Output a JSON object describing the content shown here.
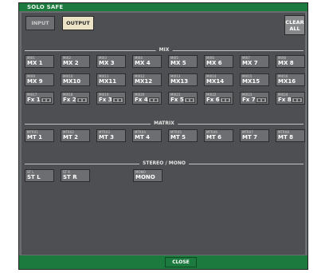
{
  "window": {
    "title": "SOLO SAFE"
  },
  "tabs": {
    "input": "INPUT",
    "output": "OUTPUT"
  },
  "clear": {
    "line1": "CLEAR",
    "line2": "ALL"
  },
  "sections": {
    "mix": "MIX",
    "matrix": "MATRIX",
    "stereo_mono": "STEREO / MONO"
  },
  "mix": [
    {
      "top": "MIX1",
      "main": "MX 1"
    },
    {
      "top": "MIX2",
      "main": "MX 2"
    },
    {
      "top": "MIX3",
      "main": "MX 3"
    },
    {
      "top": "MIX4",
      "main": "MX 4"
    },
    {
      "top": "MIX5",
      "main": "MX 5"
    },
    {
      "top": "MIX6",
      "main": "MX 6"
    },
    {
      "top": "MIX7",
      "main": "MX 7"
    },
    {
      "top": "MIX8",
      "main": "MX 8"
    },
    {
      "top": "MIX9",
      "main": "MX 9"
    },
    {
      "top": "MIX10",
      "main": "MX10"
    },
    {
      "top": "MIX11",
      "main": "MX11"
    },
    {
      "top": "MIX12",
      "main": "MX12"
    },
    {
      "top": "MIX13",
      "main": "MX13"
    },
    {
      "top": "MIX14",
      "main": "MX14"
    },
    {
      "top": "MIX15",
      "main": "MX15"
    },
    {
      "top": "MIX16",
      "main": "MX16"
    },
    {
      "top": "MIX17",
      "main": "Fx 1"
    },
    {
      "top": "MIX18",
      "main": "Fx 2"
    },
    {
      "top": "MIX19",
      "main": "Fx 3"
    },
    {
      "top": "MIX20",
      "main": "Fx 4"
    },
    {
      "top": "MIX21",
      "main": "Fx 5"
    },
    {
      "top": "MIX22",
      "main": "Fx 6"
    },
    {
      "top": "MIX23",
      "main": "Fx 7"
    },
    {
      "top": "MIX24",
      "main": "Fx 8"
    }
  ],
  "matrix": [
    {
      "top": "MTRX1",
      "main": "MT 1"
    },
    {
      "top": "MTRX2",
      "main": "MT 2"
    },
    {
      "top": "MTRX3",
      "main": "MT 3"
    },
    {
      "top": "MTRX4",
      "main": "MT 4"
    },
    {
      "top": "MTRX5",
      "main": "MT 5"
    },
    {
      "top": "MTRX6",
      "main": "MT 6"
    },
    {
      "top": "MTRX7",
      "main": "MT 7"
    },
    {
      "top": "MTRX8",
      "main": "MT 8"
    }
  ],
  "stereo": [
    {
      "top": "ST L",
      "main": "ST L"
    },
    {
      "top": "ST R",
      "main": "ST R"
    },
    {
      "top": "MONO",
      "main": "MONO"
    }
  ],
  "footer": {
    "close": "CLOSE"
  },
  "colors": {
    "title_bar": "#1c7a3f",
    "panel": "#4d4f52",
    "button": "#6c6e71",
    "output_tab_active": "#ece3c7"
  }
}
